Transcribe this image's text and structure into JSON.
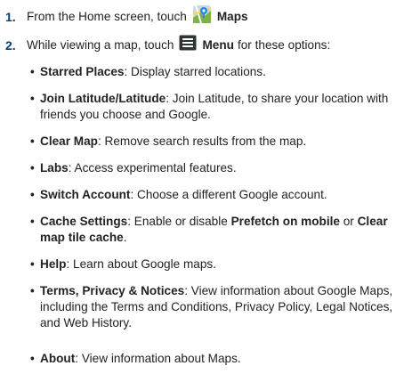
{
  "step1": {
    "number": "1.",
    "text_before": "From the Home screen, touch",
    "label": "Maps"
  },
  "step2": {
    "number": "2.",
    "text_before": "While viewing a map, touch",
    "label": "Menu",
    "text_after": "for these options:"
  },
  "bullets": [
    {
      "term": "Starred Places",
      "desc": ": Display starred locations."
    },
    {
      "term": "Join Latitude/Latitude",
      "desc": ": Join Latitude, to share your location with friends you choose and Google."
    },
    {
      "term": "Clear Map",
      "desc": ": Remove search results from the map."
    },
    {
      "term": "Labs",
      "desc": ": Access experimental features."
    },
    {
      "term": "Switch Account",
      "desc": ": Choose a different Google account."
    },
    {
      "term": "Cache Settings",
      "desc_a": ": Enable or disable ",
      "term_b": "Prefetch on mobile",
      "desc_b": " or ",
      "term_c": "Clear map tile cache",
      "desc_c": "."
    },
    {
      "term": "Help",
      "desc": ": Learn about Google maps."
    },
    {
      "term": "Terms, Privacy & Notices",
      "desc": ": View information about Google Maps, including the Terms and Conditions, Privacy Policy, Legal Notices, and Web History."
    },
    {
      "term": "About",
      "desc": ": View information about Maps."
    }
  ],
  "bullet_char": "•"
}
